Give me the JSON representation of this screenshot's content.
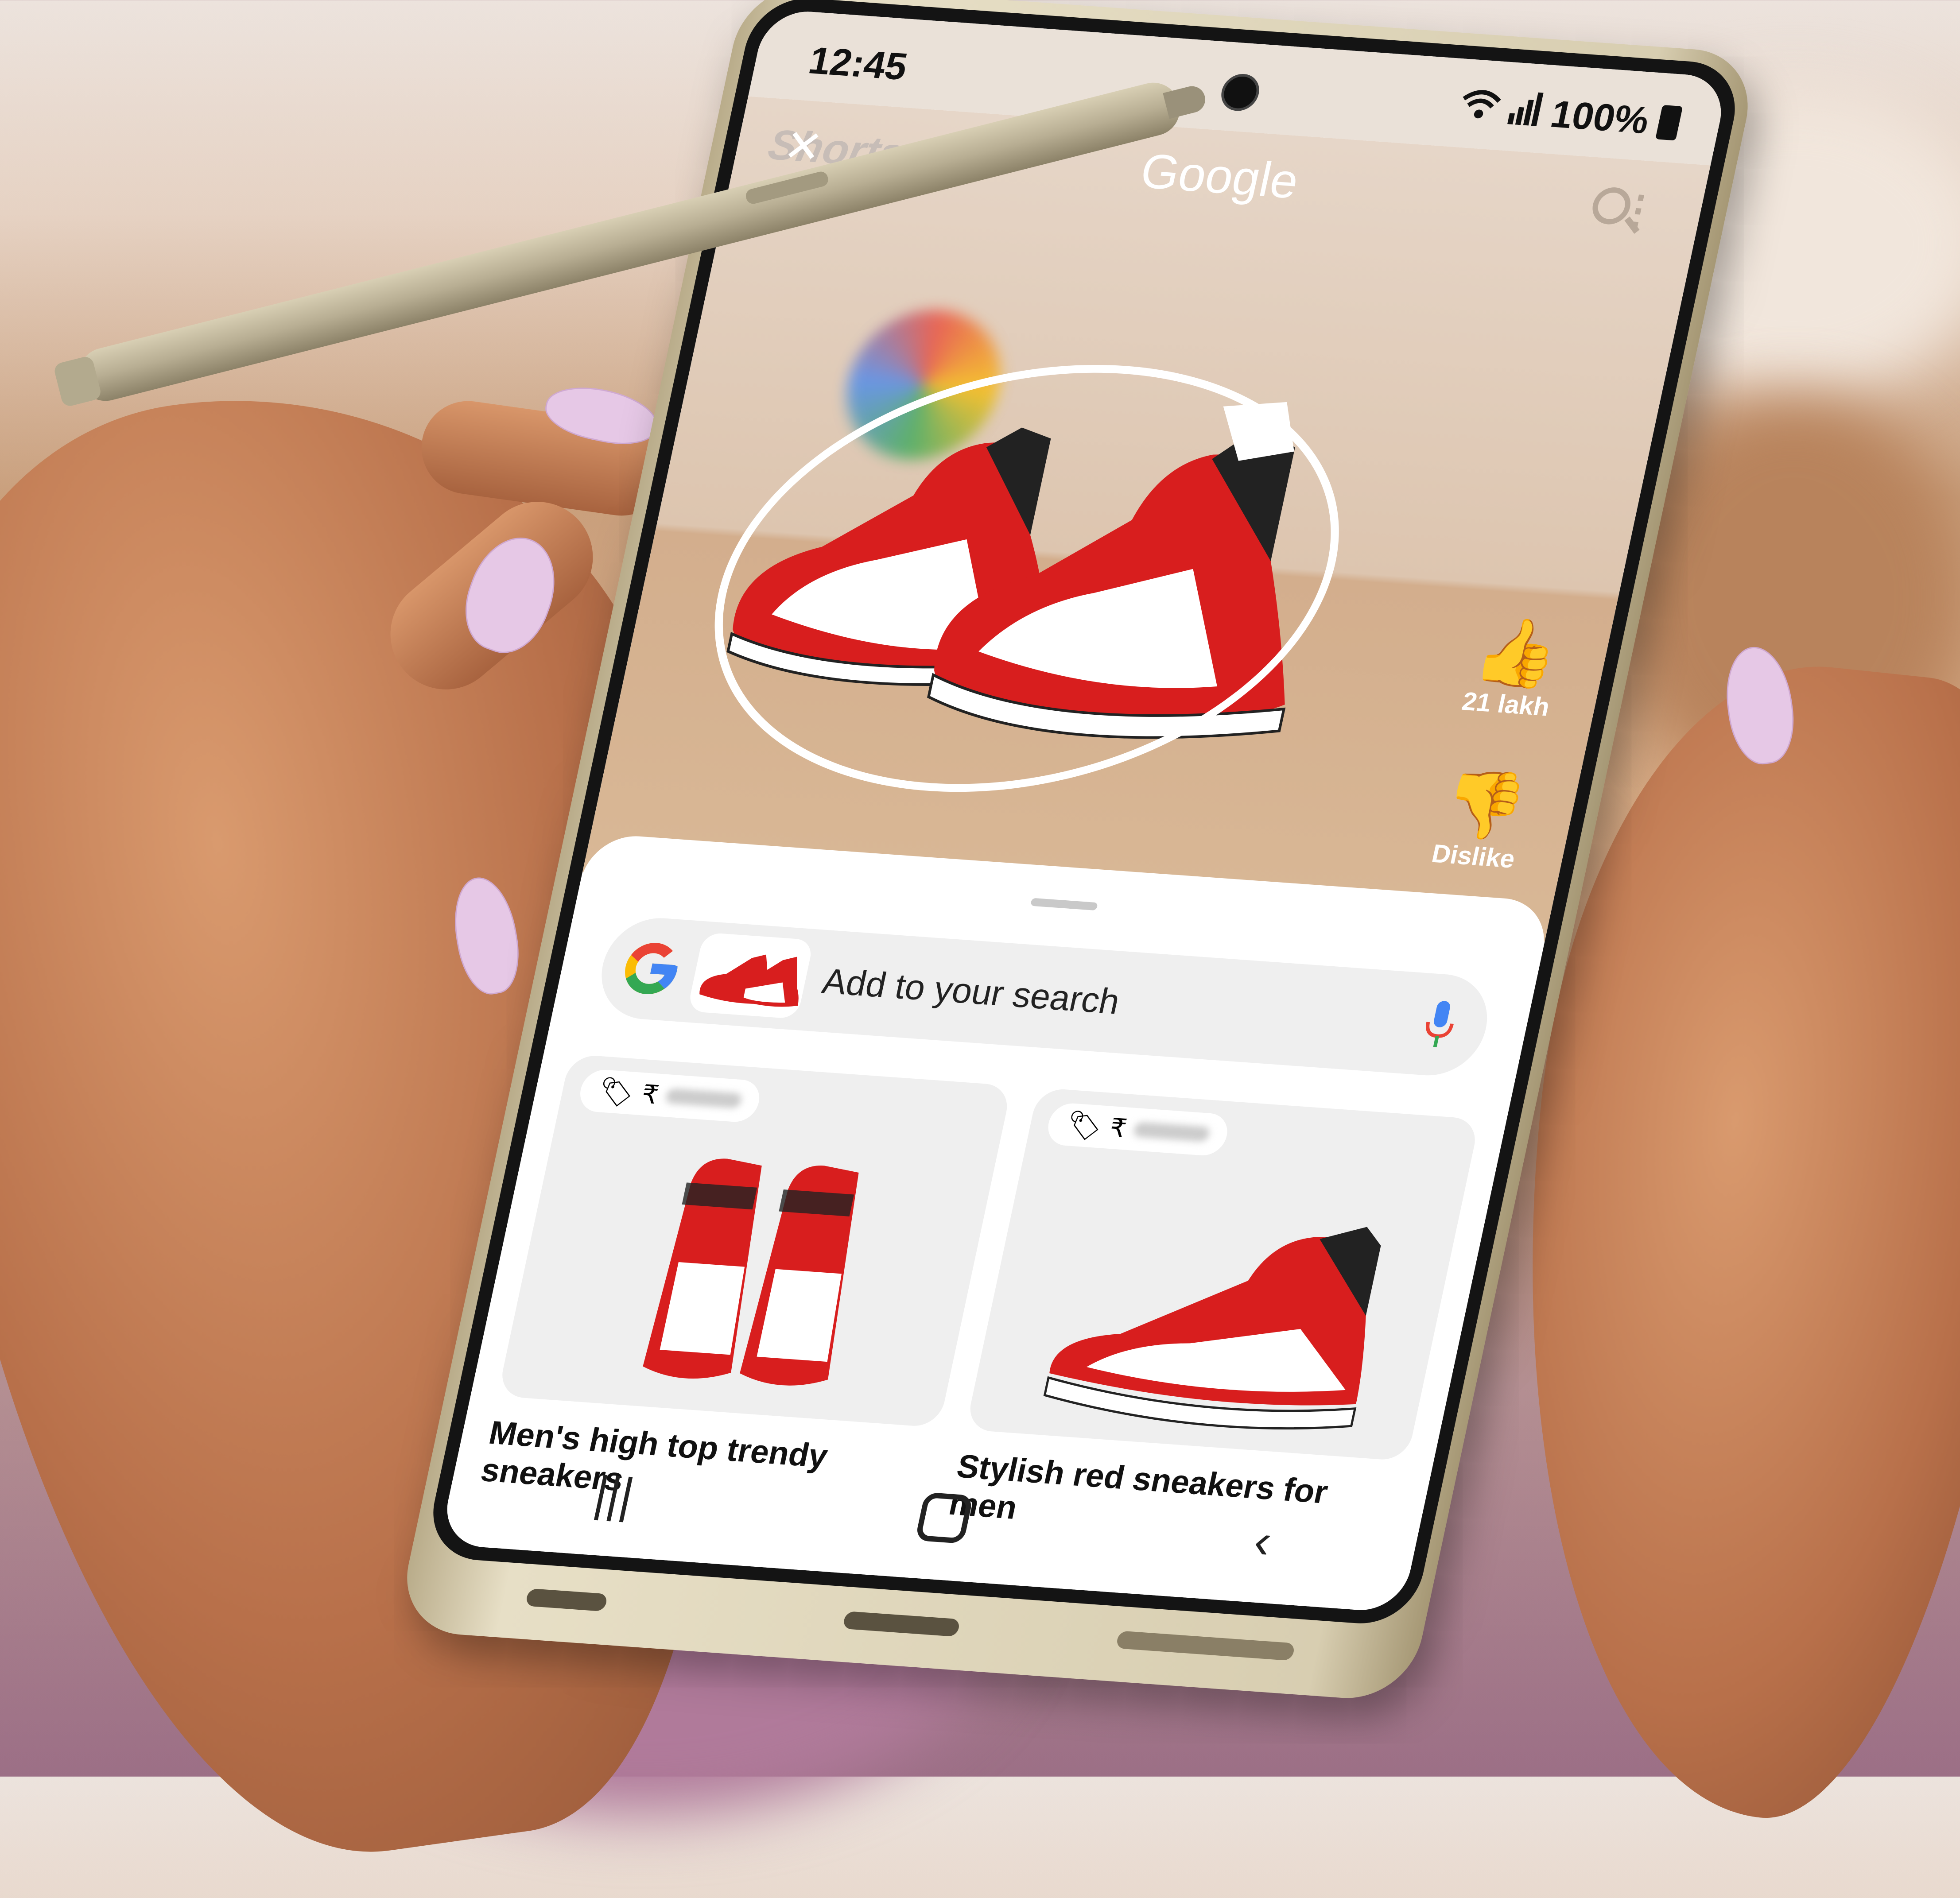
{
  "status_bar": {
    "time": "12:45",
    "battery": "100%"
  },
  "header": {
    "shorts_label": "Shorts",
    "title": "Google"
  },
  "actions": {
    "like_count": "21 lakh",
    "dislike_label": "Dislike"
  },
  "search": {
    "placeholder": "Add to your search"
  },
  "results": [
    {
      "title": "Men's high top trendy sneakers",
      "currency": "₹"
    },
    {
      "title": "Stylish red sneakers for men",
      "currency": "₹"
    }
  ],
  "colors": {
    "accent_red": "#d81e1e",
    "google_blue": "#4285f4",
    "google_red": "#ea4335",
    "google_yellow": "#fbbc05",
    "google_green": "#34a853"
  }
}
